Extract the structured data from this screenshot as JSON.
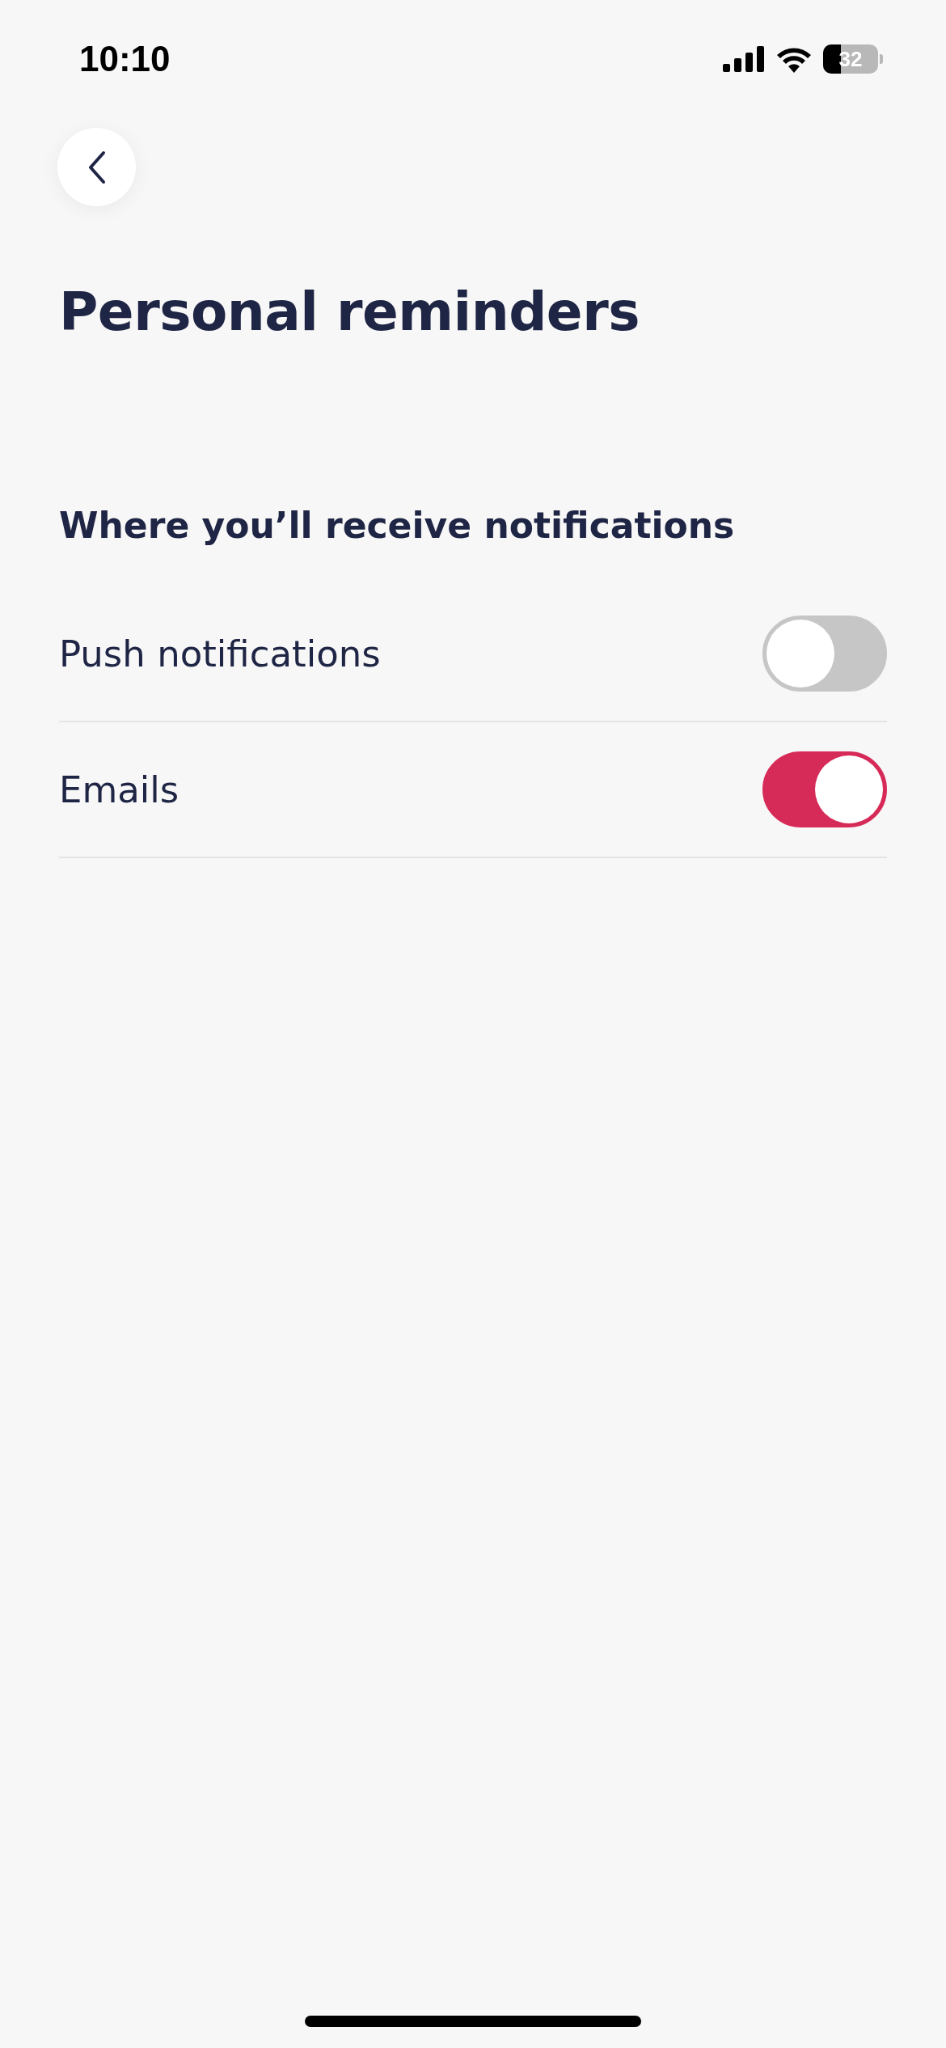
{
  "status_bar": {
    "time": "10:10",
    "battery": "32"
  },
  "title": "Personal reminders",
  "section_heading": "Where you’ll receive notifications",
  "settings": [
    {
      "label": "Push notifications",
      "on": false
    },
    {
      "label": "Emails",
      "on": true
    }
  ]
}
